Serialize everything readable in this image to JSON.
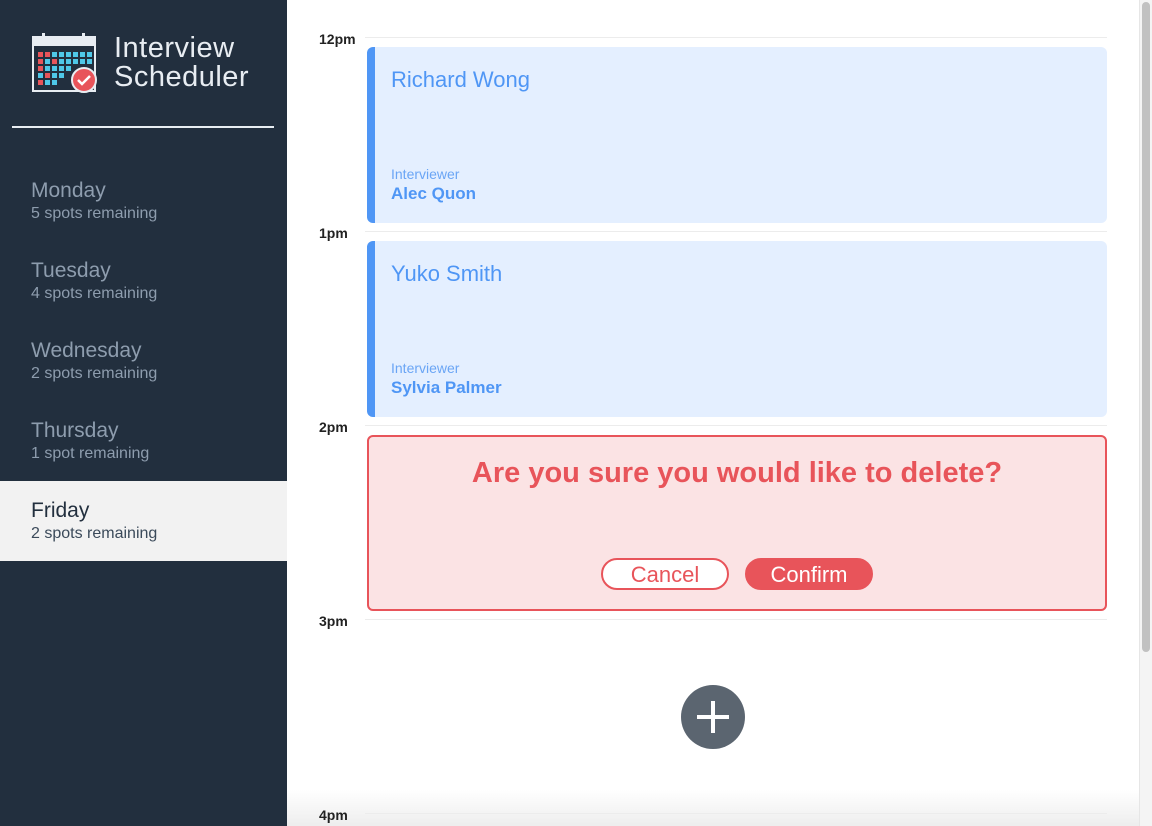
{
  "app": {
    "title_line1": "Interview",
    "title_line2": "Scheduler"
  },
  "days": [
    {
      "name": "Monday",
      "spots": "5 spots remaining",
      "selected": false
    },
    {
      "name": "Tuesday",
      "spots": "4 spots remaining",
      "selected": false
    },
    {
      "name": "Wednesday",
      "spots": "2 spots remaining",
      "selected": false
    },
    {
      "name": "Thursday",
      "spots": "1 spot remaining",
      "selected": false
    },
    {
      "name": "Friday",
      "spots": "2 spots remaining",
      "selected": true
    }
  ],
  "times": [
    "12pm",
    "1pm",
    "2pm",
    "3pm",
    "4pm"
  ],
  "appointments": [
    {
      "student": "Richard Wong",
      "interviewer_label": "Interviewer",
      "interviewer": "Alec Quon"
    },
    {
      "student": "Yuko Smith",
      "interviewer_label": "Interviewer",
      "interviewer": "Sylvia Palmer"
    }
  ],
  "confirm": {
    "message": "Are you sure you would like to delete?",
    "cancel_label": "Cancel",
    "confirm_label": "Confirm"
  },
  "icons": {
    "logo": "calendar-check-icon",
    "add": "plus-icon"
  },
  "colors": {
    "sidebar": "#222f3e",
    "appointment_bg": "#e4efff",
    "appointment_accent": "#4f96f5",
    "danger": "#e8545a",
    "danger_bg": "#fbe3e4",
    "selected_day_bg": "#f2f2f2"
  }
}
